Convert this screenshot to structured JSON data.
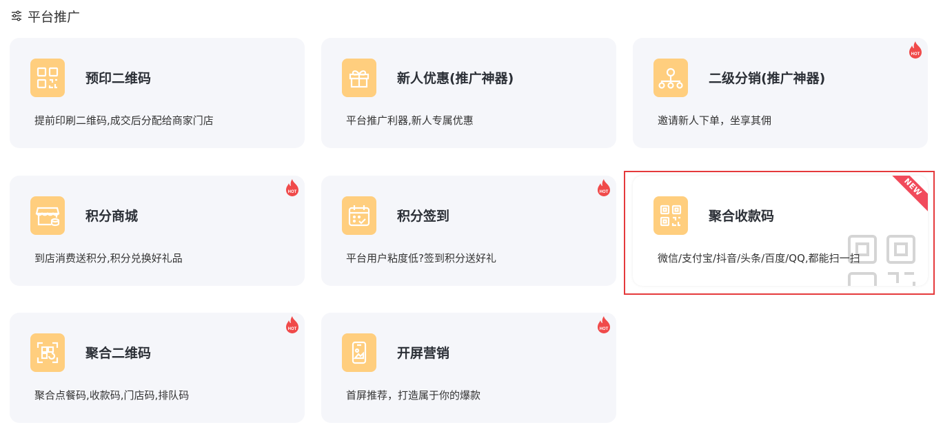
{
  "header": {
    "title": "平台推广",
    "icon": "sliders-icon"
  },
  "cards": [
    {
      "id": "preprint-qr",
      "title": "预印二维码",
      "desc": "提前印刷二维码,成交后分配给商家门店",
      "icon": "qrcode-icon",
      "badge": ""
    },
    {
      "id": "new-user-promo",
      "title": "新人优惠(推广神器)",
      "desc": "平台推广利器,新人专属优惠",
      "icon": "gift-icon",
      "badge": ""
    },
    {
      "id": "two-level-distribution",
      "title": "二级分销(推广神器)",
      "desc": "邀请新人下单，坐享其佣",
      "icon": "network-icon",
      "badge": "HOT"
    },
    {
      "id": "points-mall",
      "title": "积分商城",
      "desc": "到店消费送积分,积分兑换好礼品",
      "icon": "store-icon",
      "badge": "HOT"
    },
    {
      "id": "points-checkin",
      "title": "积分签到",
      "desc": "平台用户粘度低?签到积分送好礼",
      "icon": "calendar-check-icon",
      "badge": "HOT"
    },
    {
      "id": "aggregate-payment-code",
      "title": "聚合收款码",
      "desc": "微信/支付宝/抖音/头条/百度/QQ,都能扫一扫",
      "icon": "qrcode-icon",
      "badge": "NEW"
    },
    {
      "id": "aggregate-qr",
      "title": "聚合二维码",
      "desc": "聚合点餐码,收款码,门店码,排队码",
      "icon": "scan-qr-icon",
      "badge": "HOT"
    },
    {
      "id": "splash-marketing",
      "title": "开屏营销",
      "desc": "首屏推荐，打造属于你的爆款",
      "icon": "phone-image-icon",
      "badge": "HOT"
    }
  ],
  "colors": {
    "icon_bg": "#ffce7e",
    "card_bg": "#f5f6fa",
    "hot": "#f04a4a",
    "new": "#f14a5b",
    "highlight": "#e5393b"
  }
}
